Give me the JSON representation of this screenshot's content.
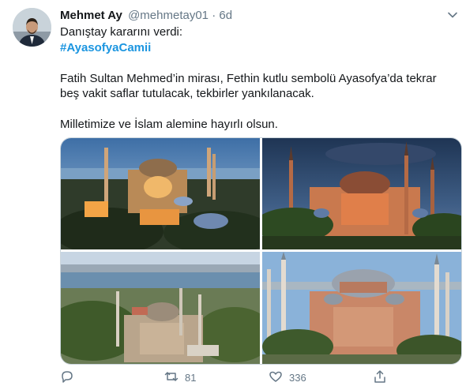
{
  "tweet": {
    "display_name": "Mehmet Ay",
    "handle": "@mehmetay01",
    "separator": "·",
    "time": "6d",
    "line1": "Danıştay kararını verdi:",
    "hashtag": "#AyasofyaCamii",
    "para2_line1": "Fatih Sultan Mehmed’in mirası, Fethin kutlu sembolü Ayasofya’da tekrar",
    "para2_line2": "beş vakit saflar tutulacak, tekbirler yankılanacak.",
    "para3": "Milletimize ve İslam alemine hayırlı olsun."
  },
  "actions": {
    "reply_icon": "reply-icon",
    "retweet_icon": "retweet-icon",
    "retweet_count": "81",
    "like_icon": "like-icon",
    "like_count": "336",
    "share_icon": "share-icon"
  },
  "colors": {
    "link": "#1b95e0",
    "secondary_text": "#657786",
    "border": "#ccd6dd"
  }
}
